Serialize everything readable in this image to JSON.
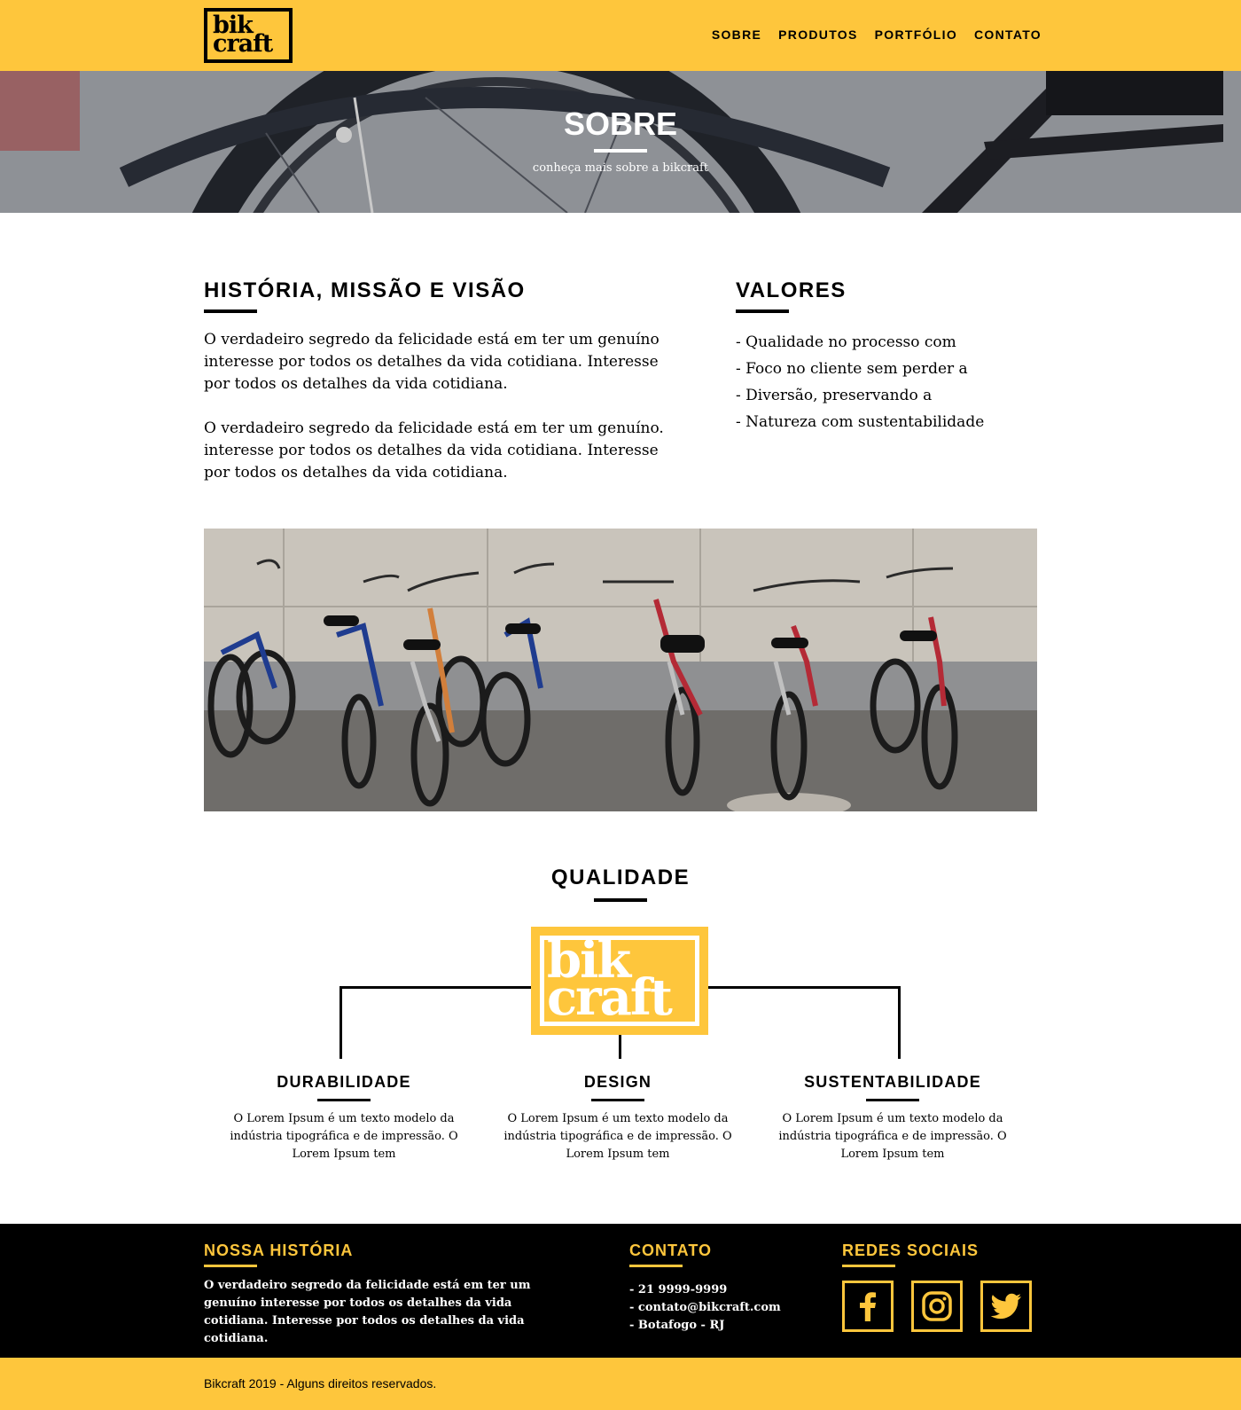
{
  "brand": {
    "logo_line1": "bik",
    "logo_line2": "craft",
    "color": "#fec63c"
  },
  "nav": {
    "items": [
      "SOBRE",
      "PRODUTOS",
      "PORTFÓLIO",
      "CONTATO"
    ]
  },
  "hero": {
    "title": "SOBRE",
    "subtitle": "conheça mais sobre a bikcraft"
  },
  "history": {
    "title": "HISTÓRIA, MISSÃO E VISÃO",
    "p1": "O verdadeiro segredo da felicidade está em ter um genuíno interesse por todos os detalhes da vida cotidiana. Interesse por todos os detalhes da vida cotidiana.",
    "p2": "O verdadeiro segredo da felicidade está em ter um genuíno. interesse por todos os detalhes da vida cotidiana. Interesse por todos os detalhes da vida cotidiana."
  },
  "values": {
    "title": "VALORES",
    "items": [
      "- Qualidade no processo com",
      "- Foco no cliente sem perder a",
      "- Diversão, preservando a",
      "- Natureza com sustentabilidade"
    ]
  },
  "quality": {
    "title": "QUALIDADE",
    "items": [
      {
        "title": "DURABILIDADE",
        "text": "O Lorem Ipsum é um texto modelo da indústria tipográfica e de impressão. O Lorem Ipsum tem"
      },
      {
        "title": "DESIGN",
        "text": "O Lorem Ipsum é um texto modelo da indústria tipográfica e de impressão. O Lorem Ipsum tem"
      },
      {
        "title": "SUSTENTABILIDADE",
        "text": "O Lorem Ipsum é um texto modelo da indústria tipográfica e de impressão. O Lorem Ipsum tem"
      }
    ]
  },
  "footer": {
    "history_title": "NOSSA HISTÓRIA",
    "history_text": "O verdadeiro segredo da felicidade está em ter um genuíno interesse por todos os detalhes da vida cotidiana. Interesse por todos os detalhes da vida cotidiana.",
    "contact_title": "CONTATO",
    "contact_items": [
      "- 21 9999-9999",
      "- contato@bikcraft.com",
      "- Botafogo - RJ"
    ],
    "social_title": "REDES SOCIAIS",
    "social_icons": [
      "facebook-icon",
      "instagram-icon",
      "twitter-icon"
    ],
    "copyright": "Bikcraft 2019 - Alguns direitos reservados."
  }
}
